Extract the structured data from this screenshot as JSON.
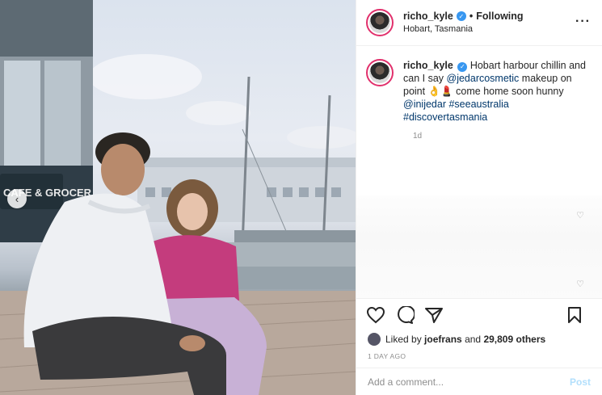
{
  "post": {
    "username": "richo_kyle",
    "separator": "•",
    "follow_status": "Following",
    "location": "Hobart, Tasmania",
    "more_icon": "more-horizontal-icon"
  },
  "photo": {
    "sign_text": "CAFE & GROCER",
    "prev_icon": "chevron-left-icon"
  },
  "caption": {
    "username": "richo_kyle",
    "text_1": "Hobart harbour chillin and can I say ",
    "mention_1": "@jedarcosmetic",
    "text_2": " makeup on point 👌💄 come home soon hunny ",
    "mention_2": "@inijedar",
    "hashtag_1": "#seeaustralia",
    "hashtag_2": "#discovertasmania",
    "time_ago": "1d"
  },
  "actions": {
    "like_icon": "heart-icon",
    "comment_icon": "comment-icon",
    "share_icon": "send-icon",
    "save_icon": "bookmark-icon"
  },
  "likes": {
    "prefix": "Liked by ",
    "liked_by": "joefrans",
    "conjunction": " and ",
    "others": "29,809 others"
  },
  "date_label": "1 DAY AGO",
  "comment": {
    "placeholder": "Add a comment...",
    "post_label": "Post"
  },
  "colors": {
    "link": "#00376b",
    "verified": "#3897f0",
    "post_disabled": "#b2dffc",
    "muted": "#8e8e8e"
  }
}
